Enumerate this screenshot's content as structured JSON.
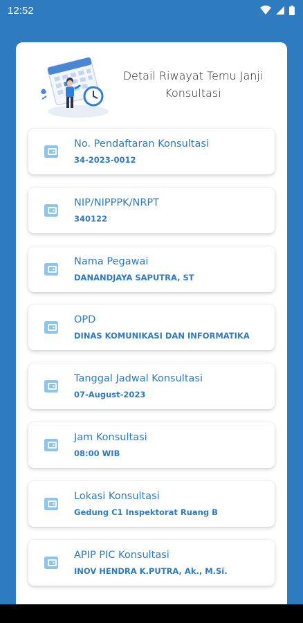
{
  "status_bar": {
    "time": "12:52",
    "icons": [
      "wifi-icon",
      "signal-icon",
      "battery-icon"
    ]
  },
  "header": {
    "title_line1": "Detail Riwayat Temu Janji",
    "title_line2": "Konsultasi",
    "illustration": "calendar-person-clock-illustration"
  },
  "items": [
    {
      "label": "No. Pendaftaran Konsultasi",
      "value": "34-2023-0012"
    },
    {
      "label": "NIP/NIPPPK/NRPT",
      "value": "340122"
    },
    {
      "label": "Nama Pegawai",
      "value": "DANANDJAYA SAPUTRA, ST"
    },
    {
      "label": "OPD",
      "value": "DINAS KOMUNIKASI DAN INFORMATIKA"
    },
    {
      "label": "Tanggal Jadwal Konsultasi",
      "value": "07-August-2023"
    },
    {
      "label": "Jam Konsultasi",
      "value": "08:00 WIB"
    },
    {
      "label": "Lokasi Konsultasi",
      "value": "Gedung C1 Inspektorat Ruang B"
    },
    {
      "label": "APIP PIC Konsultasi",
      "value": "INOV HENDRA K.PUTRA, Ak., M.Si."
    }
  ],
  "colors": {
    "background": "#2e7bbf",
    "accent": "#2e7bbf",
    "icon": "#8ec3ea",
    "card": "#ffffff"
  }
}
